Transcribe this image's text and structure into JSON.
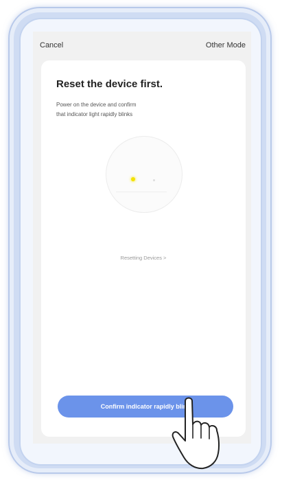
{
  "topbar": {
    "cancel_label": "Cancel",
    "other_mode_label": "Other Mode"
  },
  "card": {
    "title": "Reset the device first.",
    "description_line1": "Power on the device and confirm",
    "description_line2": "that indicator light rapidly blinks",
    "reset_link_label": "Resetting Devices >",
    "confirm_button_label": "Confirm indicator rapidly blink"
  },
  "colors": {
    "accent_button": "#6b93ea",
    "indicator_light": "#f4e200",
    "phone_frame": "#cfdcf3"
  },
  "icons": {
    "pointer": "hand-pointer-icon",
    "device": "device-icon"
  }
}
